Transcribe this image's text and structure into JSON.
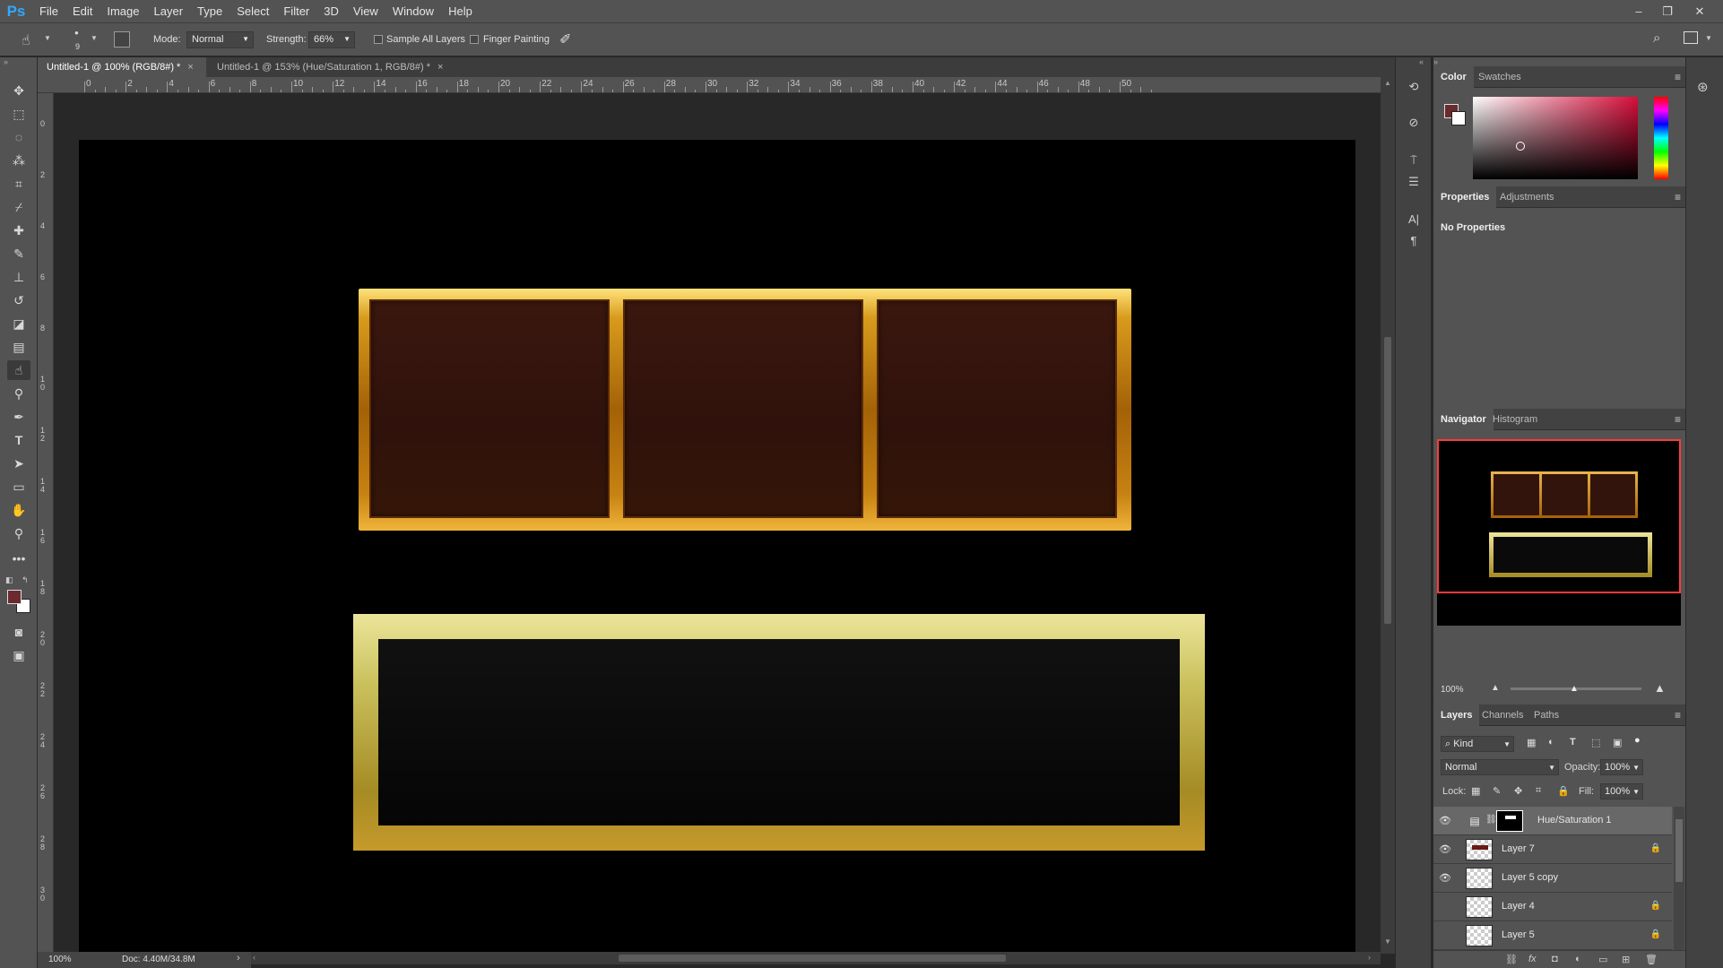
{
  "app": {
    "logo": "Ps",
    "menu": [
      "File",
      "Edit",
      "Image",
      "Layer",
      "Type",
      "Select",
      "Filter",
      "3D",
      "View",
      "Window",
      "Help"
    ],
    "window_controls": {
      "minimize": "–",
      "restore": "❐",
      "close": "✕"
    }
  },
  "options": {
    "brush_size": "9",
    "mode_label": "Mode:",
    "mode_value": "Normal",
    "strength_label": "Strength:",
    "strength_value": "66%",
    "sample_all_layers": "Sample All Layers",
    "finger_painting": "Finger Painting"
  },
  "tabs": [
    {
      "label": "Untitled-1 @ 100% (RGB/8#) *",
      "close": "×"
    },
    {
      "label": "Untitled-1 @ 153% (Hue/Saturation 1, RGB/8#) *",
      "close": "×"
    }
  ],
  "ruler_top": [
    "0",
    "2",
    "4",
    "6",
    "8",
    "10",
    "12",
    "14",
    "16",
    "18",
    "20",
    "22",
    "24",
    "26",
    "28",
    "30",
    "32",
    "34",
    "36",
    "38",
    "40",
    "42",
    "44",
    "46",
    "48",
    "50"
  ],
  "ruler_left": [
    "0",
    "2",
    "4",
    "6",
    "8",
    "1 0",
    "1 2",
    "1 4",
    "1 6",
    "1 8",
    "2 0",
    "2 2",
    "2 4",
    "2 6",
    "2 8",
    "3 0"
  ],
  "status": {
    "zoom": "100%",
    "doc": "Doc: 4.40M/34.8M"
  },
  "panels": {
    "color_tabs": [
      "Color",
      "Swatches"
    ],
    "properties_tabs": [
      "Properties",
      "Adjustments"
    ],
    "no_properties": "No Properties",
    "navigator_tabs": [
      "Navigator",
      "Histogram"
    ],
    "navigator_zoom": "100%",
    "layers_tabs": [
      "Layers",
      "Channels",
      "Paths"
    ],
    "kind": "Kind",
    "blend_mode": "Normal",
    "opacity_label": "Opacity:",
    "opacity_value": "100%",
    "lock_label": "Lock:",
    "fill_label": "Fill:",
    "fill_value": "100%"
  },
  "layers": [
    {
      "name": "Hue/Saturation 1",
      "visible": true,
      "locked": false
    },
    {
      "name": "Layer 7",
      "visible": true,
      "locked": true
    },
    {
      "name": "Layer 5 copy",
      "visible": true,
      "locked": false
    },
    {
      "name": "Layer 4",
      "visible": false,
      "locked": true
    },
    {
      "name": "Layer 5",
      "visible": false,
      "locked": true
    }
  ],
  "colors": {
    "foreground": "#6b2a2e",
    "background": "#ffffff",
    "accent": "#31a8ff"
  }
}
